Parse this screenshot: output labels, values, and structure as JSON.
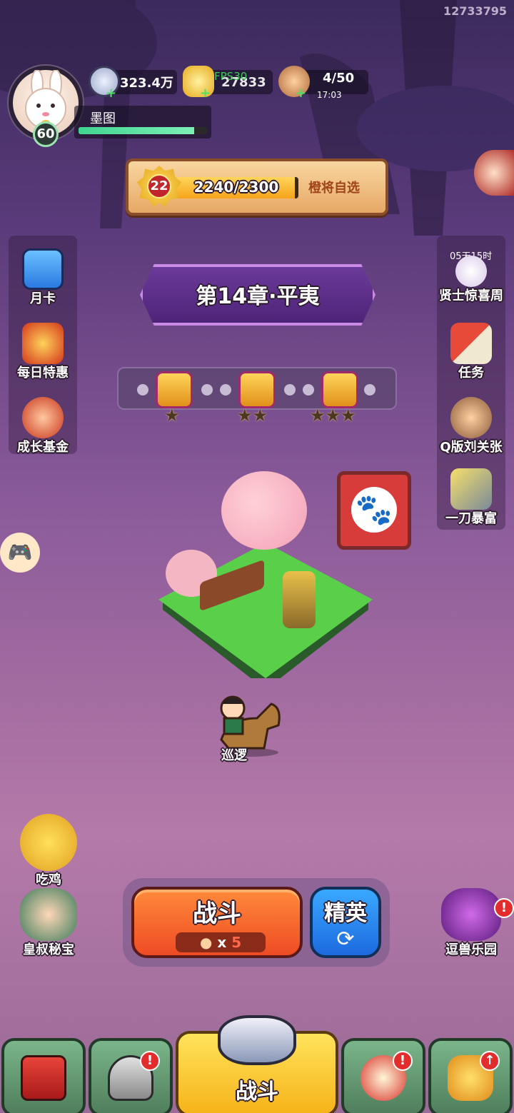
{
  "header": {
    "uid": "12733795",
    "player_name": "墨图",
    "player_level": "60",
    "xp_fraction": 0.9,
    "silver": "323.4万",
    "gold": "27833",
    "fps_overlay": "FPS30",
    "stamina": "4/50",
    "stamina_timer": "17:03"
  },
  "rank_banner": {
    "level": "22",
    "progress": "2240/2300",
    "progress_fraction": 0.974,
    "pick_label": "橙将自选"
  },
  "left_menu": [
    {
      "label": "月卡",
      "icon": "calendar-card-icon"
    },
    {
      "label": "每日特惠",
      "icon": "gift-bag-icon"
    },
    {
      "label": "成长基金",
      "icon": "fund-character-icon"
    }
  ],
  "right_menu": [
    {
      "label": "贤士惊喜周",
      "timer": "05天15时",
      "icon": "sage-character-icon"
    },
    {
      "label": "任务",
      "icon": "scroll-icon"
    },
    {
      "label": "Q版刘关张",
      "icon": "heroes-trio-icon"
    },
    {
      "label": "一刀暴富",
      "icon": "sword-treasure-icon"
    }
  ],
  "chapter": {
    "title": "第14章·平夷"
  },
  "chapter_progress": {
    "chests": [
      {
        "stars": "★"
      },
      {
        "stars": "★★"
      },
      {
        "stars": "★★★"
      }
    ]
  },
  "map": {
    "patrol_label": "巡逻"
  },
  "bottom_left": [
    {
      "label": "吃鸡",
      "icon": "chicken-character-icon"
    },
    {
      "label": "皇叔秘宝",
      "icon": "uncle-treasure-icon"
    }
  ],
  "bottom_right": {
    "label": "逗兽乐园",
    "icon": "beast-park-icon",
    "badge": "!"
  },
  "battle": {
    "fight_label": "战斗",
    "cost_times": "x",
    "cost_value": "5",
    "elite_label": "精英",
    "refresh_glyph": "⟳"
  },
  "nav": {
    "tabs": [
      {
        "name": "city",
        "icon": "castle-icon",
        "badge": ""
      },
      {
        "name": "heroes",
        "icon": "helmet-icon",
        "badge": "!"
      },
      {
        "name": "battle",
        "icon": "crossed-swords-icon",
        "label": "战斗",
        "badge": ""
      },
      {
        "name": "gacha",
        "icon": "horn-icon",
        "badge": "!"
      },
      {
        "name": "upgrade",
        "icon": "fist-upgrade-icon",
        "badge": "↑"
      }
    ]
  },
  "colors": {
    "fight_button": "#ee4b24",
    "elite_button": "#1d6adf",
    "xp_bar": "#3fd48f",
    "level_bar": "#f6a41a"
  }
}
